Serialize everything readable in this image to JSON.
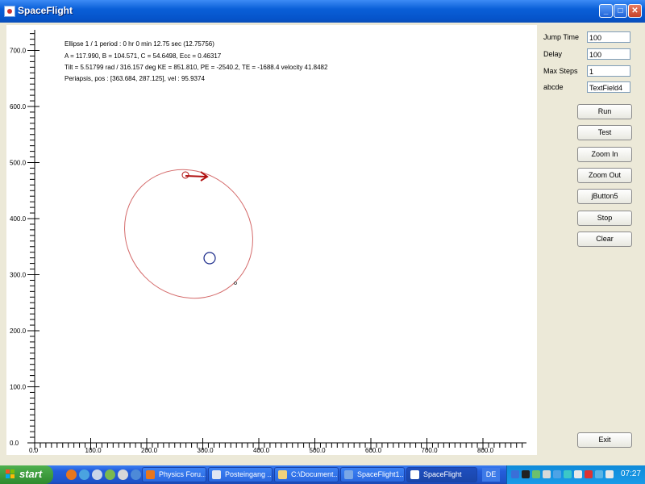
{
  "window": {
    "title": "SpaceFlight"
  },
  "info": {
    "line1": "Ellipse   1 / 1    period : 0 hr   0 min   12.75 sec   (12.75756)",
    "line2": "A = 117.990, B = 104.571, C = 54.6498,     Ecc = 0.46317",
    "line3": "Tilt = 5.51799 rad / 316.157 deg       KE = 851.810, PE = -2540.2, TE = -1688.4     velocity 41.8482",
    "line4": "Periapsis, pos : [363.684, 287.125],   vel : 95.9374"
  },
  "axes": {
    "x_ticks": [
      "0.0",
      "100.0",
      "200.0",
      "300.0",
      "400.0",
      "500.0",
      "600.0",
      "700.0",
      "800.0"
    ],
    "y_ticks": [
      "700.0",
      "600.0",
      "500.0",
      "400.0",
      "300.0",
      "200.0",
      "100.0",
      "0.0"
    ]
  },
  "fields": [
    {
      "label": "Jump Time",
      "value": "100"
    },
    {
      "label": "Delay",
      "value": "100"
    },
    {
      "label": "Max Steps",
      "value": "1"
    },
    {
      "label": "abcde",
      "value": "TextField4"
    }
  ],
  "buttons": {
    "run": "Run",
    "test": "Test",
    "zoom_in": "Zoom In",
    "zoom_out": "Zoom Out",
    "jbutton5": "jButton5",
    "stop": "Stop",
    "clear": "Clear",
    "exit": "Exit"
  },
  "taskbar": {
    "start_label": "start",
    "tasks": [
      "Physics Foru...",
      "Posteingang ...",
      "C:\\Document...",
      "SpaceFlight1...",
      "SpaceFlight"
    ],
    "language": "DE",
    "clock": "07:27"
  },
  "colors": {
    "orbit": "#d46a6a",
    "velocity_arrow": "#b01010",
    "central_body": "#1a2a8a"
  }
}
